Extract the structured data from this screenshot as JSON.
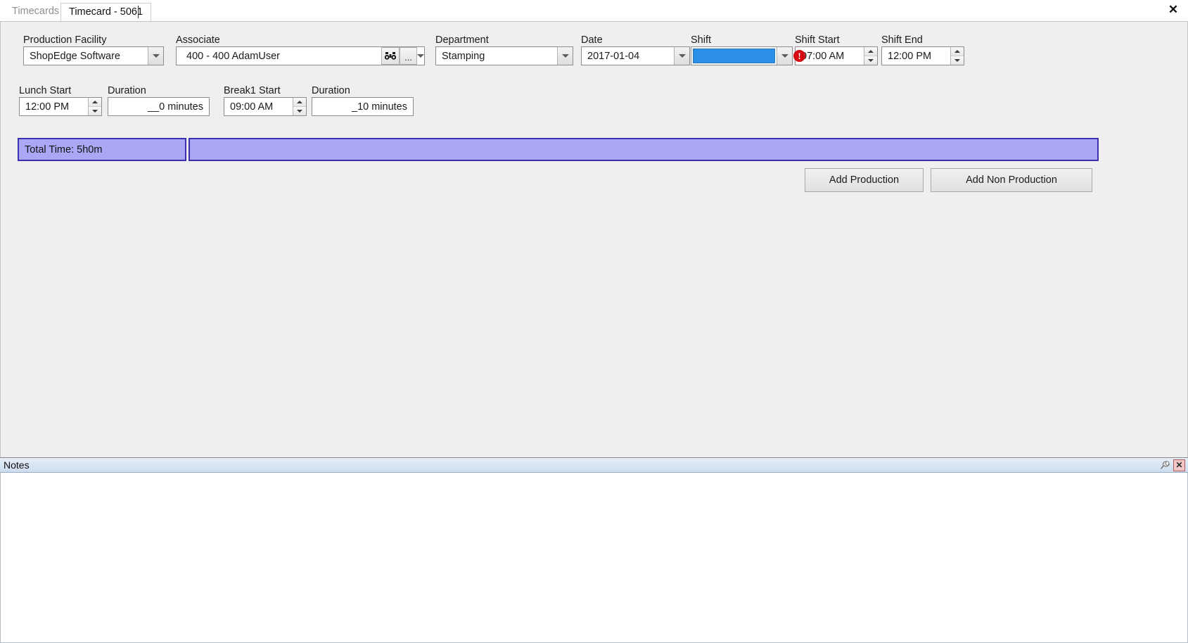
{
  "window": {
    "close_label": "✕"
  },
  "tabs": [
    {
      "label": "Timecards",
      "active": false
    },
    {
      "label": "Timecard - 5061",
      "active": true
    }
  ],
  "form": {
    "production_facility": {
      "label": "Production Facility",
      "value": "ShopEdge Software"
    },
    "associate": {
      "label": "Associate",
      "value": "400 - 400 AdamUser",
      "search_icon": "binoculars-icon",
      "browse_label": "..."
    },
    "department": {
      "label": "Department",
      "value": "Stamping"
    },
    "date": {
      "label": "Date",
      "value": "2017-01-04"
    },
    "shift": {
      "label": "Shift",
      "value": "",
      "selected": true,
      "highlight_color": "#2b8fe8"
    },
    "shift_start": {
      "label": "Shift Start",
      "value": "07:00 AM",
      "error": true,
      "error_glyph": "!",
      "error_color": "#d60b12"
    },
    "shift_end": {
      "label": "Shift End",
      "value": "12:00 PM"
    },
    "lunch_start": {
      "label": "Lunch Start",
      "value": "12:00 PM"
    },
    "lunch_duration": {
      "label": "Duration",
      "value": "__0 minutes"
    },
    "break1_start": {
      "label": "Break1 Start",
      "value": "09:00 AM"
    },
    "break1_duration": {
      "label": "Duration",
      "value": "_10 minutes"
    }
  },
  "summary": {
    "total_time_label": "Total Time: 5h0m",
    "bar_color": "#aaa8f5",
    "bar_border_color": "#3c2fb0"
  },
  "actions": {
    "add_production": "Add Production",
    "add_non_production": "Add Non Production"
  },
  "notes": {
    "title": "Notes",
    "pin_icon": "pushpin-icon",
    "close_label": "✕",
    "body_text": ""
  }
}
